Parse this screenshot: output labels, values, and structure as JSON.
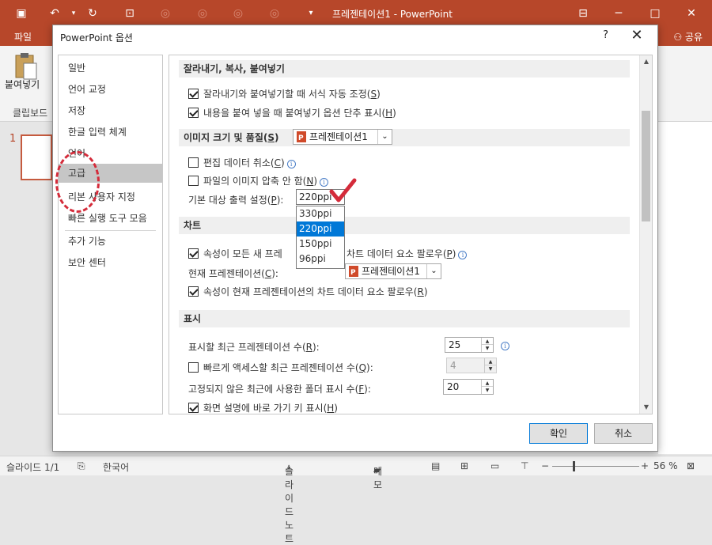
{
  "app": {
    "title": "프레젠테이션1 - PowerPoint",
    "brand_color": "#b7472a",
    "tab_file": "파일",
    "share_label": "공유",
    "paste_label": "붙여넣기",
    "clipboard_label": "클립보드",
    "slide_number": "1"
  },
  "status": {
    "slide_info": "슬라이드 1/1",
    "language": "한국어",
    "notes": "슬라이드 노트",
    "comments": "메모",
    "zoom": "56 %"
  },
  "dialog": {
    "title": "PowerPoint 옵션",
    "help": "?",
    "close": "✕",
    "nav": [
      {
        "label": "일반"
      },
      {
        "label": "언어 교정"
      },
      {
        "label": "저장"
      },
      {
        "label": "한글 입력 체계"
      },
      {
        "label": "언어"
      },
      {
        "label": "고급"
      },
      {
        "label": "리본 사용자 지정"
      },
      {
        "label": "빠른 실행 도구 모음"
      },
      {
        "label": "추가 기능"
      },
      {
        "label": "보안 센터"
      }
    ],
    "active_nav": "고급",
    "sections": {
      "cut": {
        "title": "잘라내기, 복사, 붙여넣기",
        "opt1": {
          "label": "잘라내기와 붙여넣기할 때 서식 자동 조정",
          "key": "S",
          "checked": true
        },
        "opt2": {
          "label": "내용을 붙여 넣을 때 붙여넣기 옵션 단추 표시",
          "key": "H",
          "checked": true
        }
      },
      "image": {
        "title": "이미지 크기 및 품질",
        "key": "S",
        "doc": "프레젠테이션1",
        "opt1": {
          "label": "편집 데이터 취소",
          "key": "C",
          "checked": false
        },
        "opt2": {
          "label": "파일의 이미지 압축 안 함",
          "key": "N",
          "checked": false
        },
        "dpi_label": "기본 대상 출력 설정",
        "dpi_key": "P",
        "dpi_value": "220ppi",
        "dpi_options": [
          "330ppi",
          "220ppi",
          "150ppi",
          "96ppi"
        ]
      },
      "chart": {
        "title": "차트",
        "opt1": {
          "label_a": "속성이 모든 새 프레",
          "label_b": "차트 데이터 요소 팔로우",
          "key": "P",
          "checked": true
        },
        "current_label": "현재 프레젠테이션",
        "current_key": "C",
        "doc": "프레젠테이션1",
        "opt2": {
          "label": "속성이 현재 프레젠테이션의 차트 데이터 요소 팔로우",
          "key": "R",
          "checked": true
        }
      },
      "display": {
        "title": "표시",
        "recent_label": "표시할 최근 프레젠테이션 수",
        "recent_key": "R",
        "recent_value": "25",
        "quick_label": "빠르게 액세스할 최근 프레젠테이션 수",
        "quick_key": "Q",
        "quick_value": "4",
        "quick_checked": false,
        "folders_label": "고정되지 않은 최근에 사용한 폴더 표시 수",
        "folders_key": "F",
        "folders_value": "20",
        "shortcut_label": "화면 설명에 바로 가기 키 표시",
        "shortcut_key": "H",
        "shortcut_checked": true
      }
    },
    "ok": "확인",
    "cancel": "취소"
  },
  "annotation_color": "#d42b3a"
}
